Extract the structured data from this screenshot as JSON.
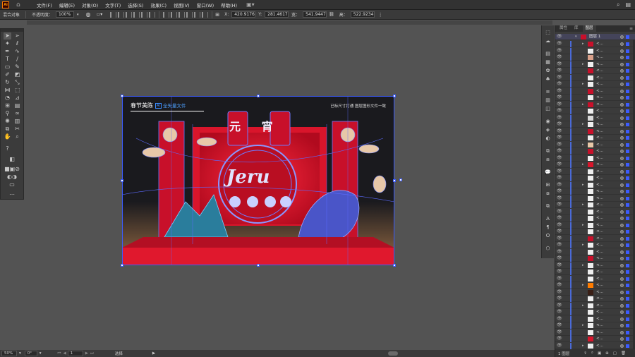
{
  "app": {
    "icon_label": "Ai"
  },
  "menubar": {
    "items": [
      "文件(F)",
      "编辑(E)",
      "对象(O)",
      "文字(T)",
      "选择(S)",
      "效果(C)",
      "视图(V)",
      "窗口(W)",
      "帮助(H)"
    ],
    "right_icons": [
      "search-icon",
      "window-layout-icon"
    ]
  },
  "controlbar": {
    "object_type": "混合对象",
    "opacity_label": "不透明度：",
    "opacity_value": "100%",
    "x_label": "X:",
    "x_value": "420.9176",
    "y_label": "Y:",
    "y_value": "281.4617",
    "w_label": "宽：",
    "w_value": "541.9447",
    "h_label": "高：",
    "h_value": "522.9234",
    "unit": "pt"
  },
  "artboard": {
    "title": "春节美陈",
    "ai_badge": "Ai",
    "vector_label": "全矢量文件",
    "note": "已标尺寸打通  图层图形文件一致",
    "center_text": "元 宵",
    "brand_text": "Jeru"
  },
  "layers_panel": {
    "tabs": [
      "属性",
      "库",
      "图层"
    ],
    "active_tab": "图层",
    "top_layer_name": "图层 1",
    "row_label": "<...",
    "footer_label": "1 图层"
  },
  "statusbar": {
    "zoom": "50%",
    "rotation": "0°",
    "artboard_number": "1",
    "tool_name": "选择"
  },
  "colors": {
    "accent": "#3b5bff",
    "artboard_red": "#e0182d",
    "ui_dark": "#323232"
  }
}
